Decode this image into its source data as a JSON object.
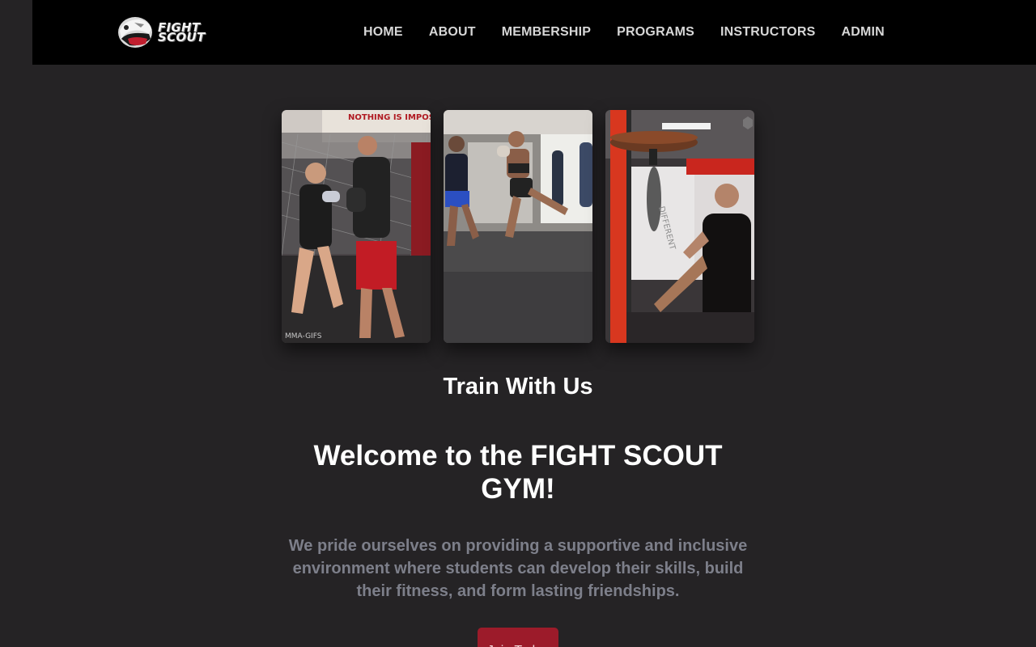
{
  "brand": {
    "name_line1": "FIGHT",
    "name_line2": "SCOUT",
    "accent_color": "#9c1b2a"
  },
  "nav": {
    "items": [
      {
        "label": "HOME"
      },
      {
        "label": "ABOUT"
      },
      {
        "label": "MEMBERSHIP"
      },
      {
        "label": "PROGRAMS"
      },
      {
        "label": "INSTRUCTORS"
      },
      {
        "label": "ADMIN"
      }
    ]
  },
  "gallery": {
    "photos": [
      {
        "icon": "sparring-photo",
        "sign_text": "NOTHING IS IMPOSSIBLE",
        "watermark": "MMA-GIFS"
      },
      {
        "icon": "kick-training-photo"
      },
      {
        "icon": "speed-bag-photo",
        "wall_text": "DIFFERENT"
      }
    ]
  },
  "main": {
    "section_heading": "Train With Us",
    "welcome": "Welcome to the FIGHT SCOUT GYM!",
    "tagline": "We pride ourselves on providing a supportive and inclusive environment where students can develop their skills, build their fitness, and form lasting friendships.",
    "cta_label": "Join Today"
  }
}
